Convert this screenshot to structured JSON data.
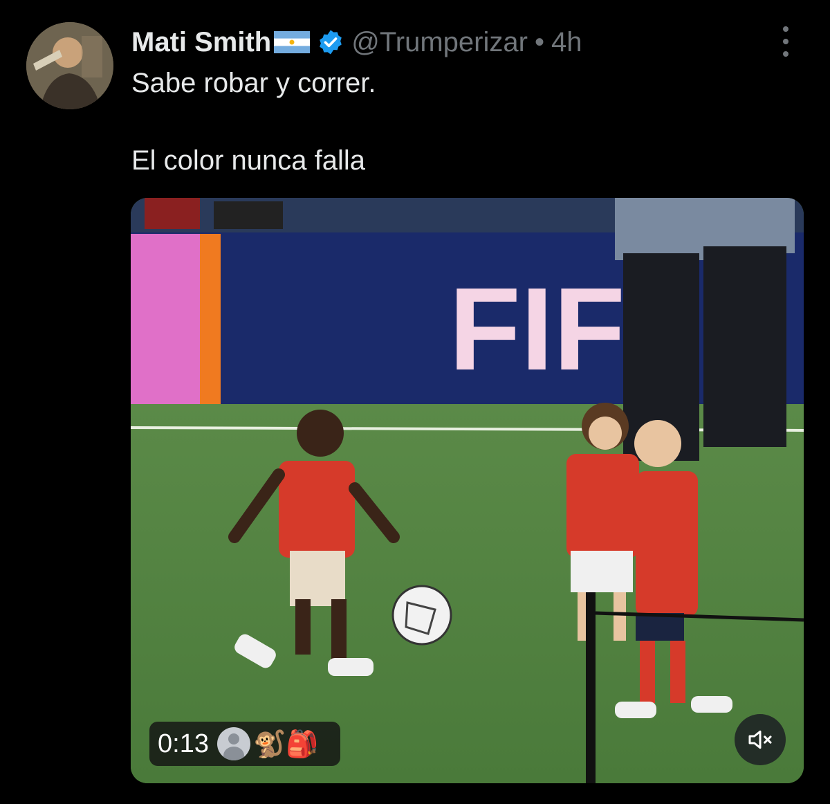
{
  "tweet": {
    "display_name": "Mati Smith",
    "flag_icon": "argentina-flag-icon",
    "verified_icon": "verified-badge-icon",
    "handle": "@Trumperizar",
    "separator": "•",
    "time": "4h",
    "text_lines": [
      "Sabe robar y correr.",
      "El color nunca falla"
    ]
  },
  "media": {
    "billboard_text": "FIF",
    "video_duration": "0:13",
    "viewer_icon": "default-avatar-icon",
    "emojis": "🐒🎒",
    "mute_icon": "muted-speaker-icon"
  },
  "colors": {
    "background": "#000000",
    "text_primary": "#e7e9ea",
    "text_secondary": "#71767b",
    "verified_blue": "#1d9bf0"
  }
}
